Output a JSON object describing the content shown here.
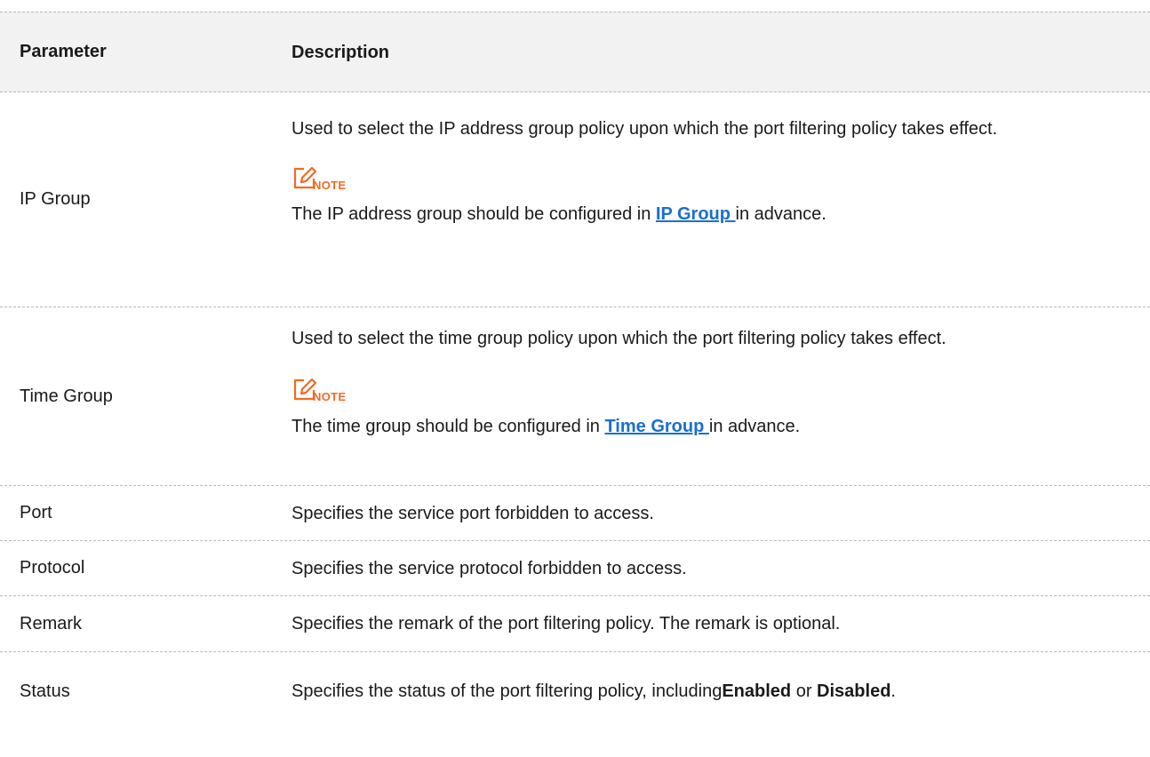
{
  "table": {
    "header": {
      "parameter": "Parameter",
      "description": "Description"
    },
    "rows": {
      "ip_group": {
        "parameter": "IP Group",
        "description": "Used to select the IP address group policy upon which the port filtering policy takes effect.",
        "note_label": "NOTE",
        "note_before": "The IP address group should be configured in ",
        "note_link": "IP Group ",
        "note_after": "in advance."
      },
      "time_group": {
        "parameter": "Time Group",
        "description": "Used to select the time group policy upon which the port filtering policy takes effect.",
        "note_label": "NOTE",
        "note_before": "The time group should be configured in ",
        "note_link": "Time Group ",
        "note_after": "in advance."
      },
      "port": {
        "parameter": "Port",
        "description": "Specifies the service port forbidden to access."
      },
      "protocol": {
        "parameter": "Protocol",
        "description": "Specifies the service protocol forbidden to access."
      },
      "remark": {
        "parameter": "Remark",
        "description": "Specifies the remark of the port filtering policy. The remark is optional."
      },
      "status": {
        "parameter": "Status",
        "description_before": "Specifies the status of the port filtering policy, including ",
        "option_enabled": "Enabled",
        "description_mid": " or ",
        "option_disabled": "Disabled",
        "description_after": "."
      }
    }
  },
  "colors": {
    "note_accent": "#f26a21",
    "link": "#1a6fd1",
    "header_bg": "#f2f2f2",
    "divider": "#b9b9b9"
  },
  "icons": {
    "note": "edit-note-icon"
  }
}
